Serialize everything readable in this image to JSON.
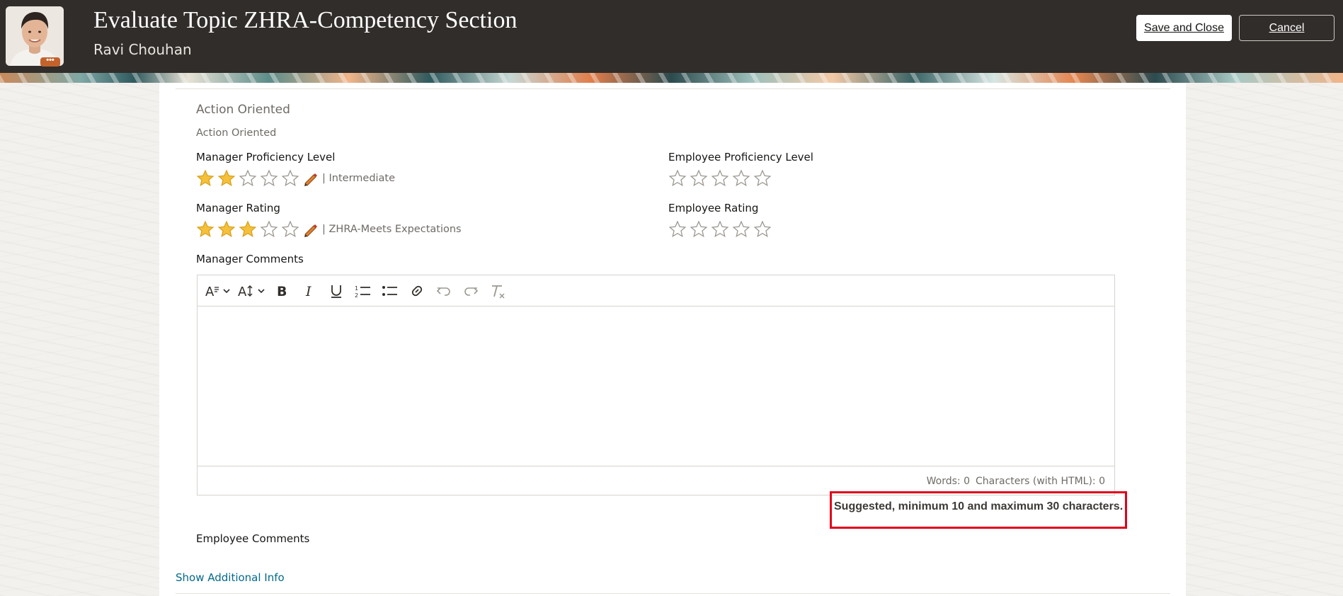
{
  "header": {
    "title": "Evaluate Topic ZHRA-Competency Section",
    "subtitle": "Ravi Chouhan",
    "avatar_badge": "•••",
    "save_label": "Save and Close",
    "cancel_label": "Cancel"
  },
  "section": {
    "title": "Action Oriented",
    "subtitle": "Action Oriented"
  },
  "manager_proficiency": {
    "label": "Manager Proficiency Level",
    "rating": 2,
    "max": 5,
    "value_text": "| Intermediate"
  },
  "employee_proficiency": {
    "label": "Employee Proficiency Level",
    "rating": 0,
    "max": 5
  },
  "manager_rating": {
    "label": "Manager Rating",
    "rating": 3,
    "max": 5,
    "value_text": "| ZHRA-Meets Expectations"
  },
  "employee_rating": {
    "label": "Employee Rating",
    "rating": 0,
    "max": 5
  },
  "manager_comments": {
    "label": "Manager Comments",
    "toolbar": [
      "font-style-icon",
      "font-size-icon",
      "bold-icon",
      "italic-icon",
      "underline-icon",
      "numbered-list-icon",
      "bulleted-list-icon",
      "link-icon",
      "undo-icon",
      "redo-icon",
      "clear-format-icon"
    ],
    "words": "Words: 0",
    "characters": "Characters (with HTML): 0",
    "hint": "Suggested, minimum 10 and maximum 30 characters."
  },
  "employee_comments": {
    "label": "Employee Comments"
  },
  "show_additional_info": "Show Additional Info",
  "colors": {
    "header_bg": "#312d2a",
    "star_filled": "#f5c03a",
    "link": "#04698b",
    "highlight": "#e2001a"
  }
}
